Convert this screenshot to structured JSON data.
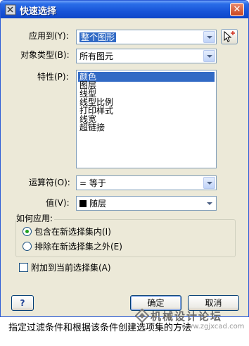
{
  "window": {
    "title": "快速选择"
  },
  "form": {
    "apply_to": {
      "label": "应用到(Y):",
      "value": "整个图形"
    },
    "object_type": {
      "label": "对象类型(B):",
      "value": "所有图元"
    },
    "properties": {
      "label": "特性(P):",
      "items": [
        "颜色",
        "图层",
        "线型",
        "线型比例",
        "打印样式",
        "线宽",
        "超链接"
      ],
      "selected": "颜色"
    },
    "operator": {
      "label": "运算符(O):",
      "value": "= 等于"
    },
    "value": {
      "label": "值(V):",
      "value": "随层"
    },
    "how_to_apply": {
      "label": "如何应用:",
      "include": "包含在新选择集内(I)",
      "exclude": "排除在新选择集之外(E)",
      "selected": "include"
    },
    "append": {
      "label": "附加到当前选择集(A)",
      "checked": false
    }
  },
  "buttons": {
    "help": "?",
    "ok": "确定",
    "cancel": "取消"
  },
  "watermark": {
    "text": "机械设计论坛",
    "url": "www.zgjxcad.com"
  },
  "caption": "指定过滤条件和根据该条件创建选项集的方法",
  "colors": {
    "title_bar": "#1854d8",
    "selection": "#316ac5",
    "dialog_bg": "#ece9d8"
  }
}
